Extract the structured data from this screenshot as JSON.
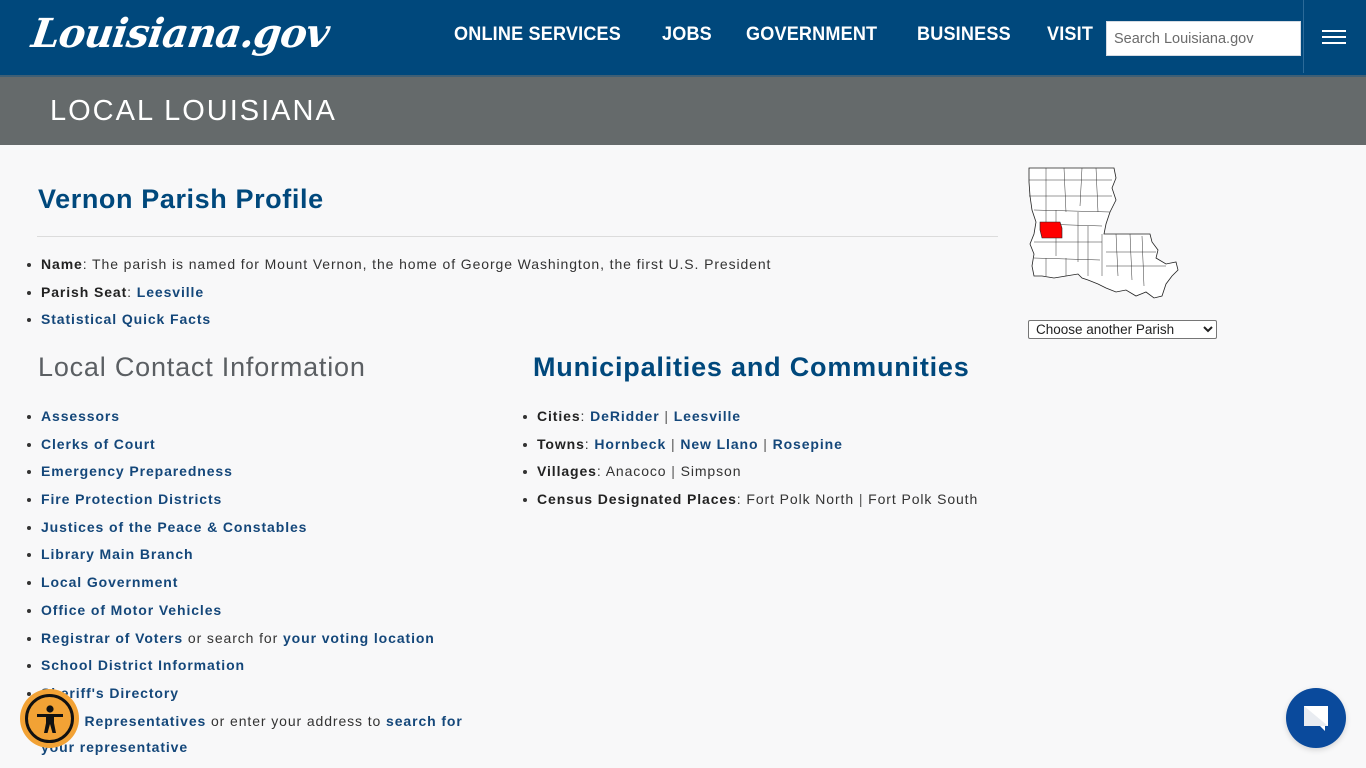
{
  "header": {
    "logo_text": "Louisiana.gov",
    "nav": [
      {
        "label": "ONLINE SERVICES"
      },
      {
        "label": "JOBS"
      },
      {
        "label": "GOVERNMENT"
      },
      {
        "label": "BUSINESS"
      },
      {
        "label": "VISIT"
      }
    ],
    "search_placeholder": "Search Louisiana.gov",
    "menu_icon": "hamburger-icon"
  },
  "banner": {
    "title": "LOCAL LOUISIANA"
  },
  "profile": {
    "title": "Vernon Parish Profile",
    "name_label": "Name",
    "name_text": ": The parish is named for Mount Vernon, the home of George Washington, the first U.S. President",
    "seat_label": "Parish Seat",
    "seat_value": "Leesville",
    "quick_facts": "Statistical Quick Facts"
  },
  "contacts": {
    "title": "Local Contact Information",
    "items": [
      "Assessors",
      "Clerks of Court",
      "Emergency Preparedness",
      "Fire Protection Districts",
      "Justices of the Peace & Constables",
      "Library Main Branch",
      "Local Government",
      "Office of Motor Vehicles"
    ],
    "registrar": {
      "link": "Registrar of Voters",
      "text": " or search for ",
      "link2": "your voting location"
    },
    "school": "School District Information",
    "sheriff": "Sheriff's Directory",
    "reps": {
      "link": "State Representatives",
      "text": " or enter your address to ",
      "link2": "search for your representative"
    }
  },
  "municipalities": {
    "title": "Municipalities and Communities",
    "cities_label": "Cities",
    "cities": [
      "DeRidder",
      "Leesville"
    ],
    "towns_label": "Towns",
    "towns": [
      "Hornbeck",
      "New Llano",
      "Rosepine"
    ],
    "villages_label": "Villages",
    "villages": [
      "Anacoco",
      "Simpson"
    ],
    "cdp_label": "Census Designated Places",
    "cdp": [
      "Fort Polk North",
      "Fort Polk South"
    ]
  },
  "sidebar": {
    "map_highlight_color": "#ff0000",
    "select_value": "Choose another Parish"
  },
  "colors": {
    "brand": "#00487c",
    "banner": "#656a6b",
    "link": "#14477a",
    "a11y": "#f2a235",
    "chat": "#0a4a9c"
  }
}
